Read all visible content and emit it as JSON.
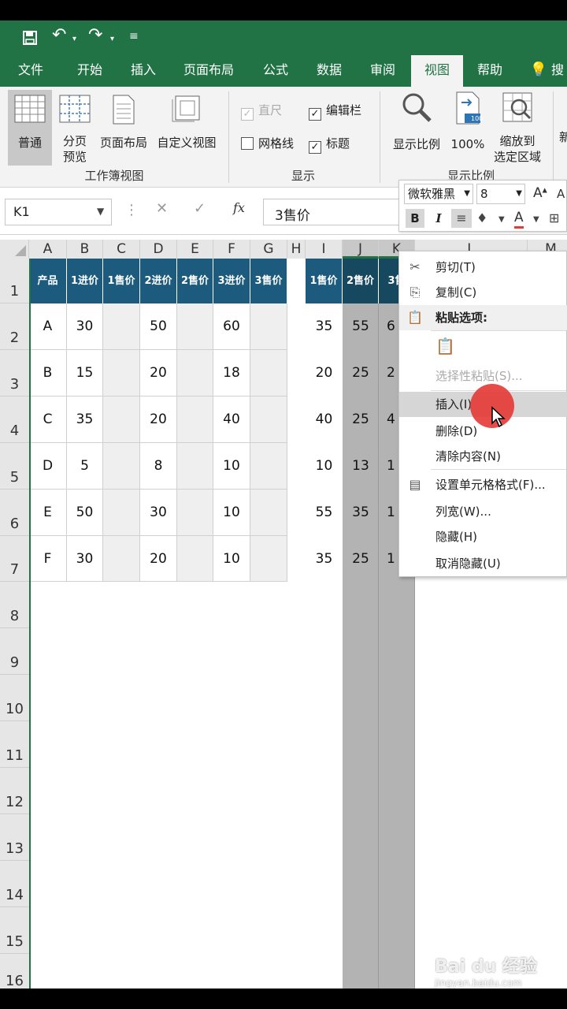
{
  "qat": {
    "save_icon": "save-icon",
    "undo_icon": "undo-icon",
    "redo_icon": "redo-icon",
    "customize_icon": "customize-qat-icon"
  },
  "tabs": [
    "文件",
    "开始",
    "插入",
    "页面布局",
    "公式",
    "数据",
    "审阅",
    "视图",
    "帮助"
  ],
  "tab_active": "视图",
  "tell_me_partial": "搜",
  "ribbon": {
    "normal": "普通",
    "pagebreak_1": "分页",
    "pagebreak_2": "预览",
    "pagelayout": "页面布局",
    "customview": "自定义视图",
    "group_workbook_views": "工作簿视图",
    "ruler": "直尺",
    "gridlines": "网格线",
    "formulabar": "编辑栏",
    "headings": "标题",
    "group_show": "显示",
    "zoom": "显示比例",
    "zoom100": "100%",
    "zoom100_badge": "100",
    "zoomsel_1": "缩放到",
    "zoomsel_2": "选定区域",
    "group_zoom": "显示比例",
    "partial_right": "新"
  },
  "namebox": "K1",
  "formula": "3售价",
  "fx": "fx",
  "columns": [
    "A",
    "B",
    "C",
    "D",
    "E",
    "F",
    "G",
    "H",
    "I",
    "J",
    "K",
    "L",
    "M"
  ],
  "rows": [
    "1",
    "2",
    "3",
    "4",
    "5",
    "6",
    "7",
    "8",
    "9",
    "10",
    "11",
    "12",
    "13",
    "14",
    "15",
    "16"
  ],
  "headers_left": [
    "产品",
    "1进价",
    "1售价",
    "2进价",
    "2售价",
    "3进价",
    "3售价"
  ],
  "headers_right": [
    "1售价",
    "2售价",
    "3售"
  ],
  "data_left": [
    [
      "A",
      "30",
      "",
      "50",
      "",
      "60",
      ""
    ],
    [
      "B",
      "15",
      "",
      "20",
      "",
      "18",
      ""
    ],
    [
      "C",
      "35",
      "",
      "20",
      "",
      "40",
      ""
    ],
    [
      "D",
      "5",
      "",
      "8",
      "",
      "10",
      ""
    ],
    [
      "E",
      "50",
      "",
      "30",
      "",
      "10",
      ""
    ],
    [
      "F",
      "30",
      "",
      "20",
      "",
      "10",
      ""
    ]
  ],
  "data_right": [
    [
      "35",
      "55",
      "6"
    ],
    [
      "20",
      "25",
      "2"
    ],
    [
      "40",
      "25",
      "4"
    ],
    [
      "10",
      "13",
      "1"
    ],
    [
      "55",
      "35",
      "1"
    ],
    [
      "35",
      "25",
      "1"
    ]
  ],
  "mini_toolbar": {
    "font": "微软雅黑",
    "size": "8",
    "bold": "B",
    "italic": "I",
    "font_color_letter": "A"
  },
  "menu": [
    {
      "label": "剪切(T)",
      "icon": "scissors-icon",
      "glyph": "✂",
      "state": "normal"
    },
    {
      "label": "复制(C)",
      "icon": "copy-icon",
      "glyph": "⎘",
      "state": "normal"
    },
    {
      "label": "粘贴选项:",
      "icon": "paste-icon",
      "glyph": "📋",
      "state": "header"
    },
    {
      "label": "",
      "icon": "paste-values-icon",
      "glyph": "📋",
      "state": "disabled"
    },
    {
      "label": "选择性粘贴(S)...",
      "icon": "",
      "glyph": "",
      "state": "disabled"
    },
    {
      "label": "插入(I)",
      "icon": "",
      "glyph": "",
      "state": "highlight"
    },
    {
      "label": "删除(D)",
      "icon": "",
      "glyph": "",
      "state": "normal"
    },
    {
      "label": "清除内容(N)",
      "icon": "",
      "glyph": "",
      "state": "normal"
    },
    {
      "label": "设置单元格格式(F)...",
      "icon": "format-cells-icon",
      "glyph": "▤",
      "state": "normal"
    },
    {
      "label": "列宽(W)...",
      "icon": "",
      "glyph": "",
      "state": "normal"
    },
    {
      "label": "隐藏(H)",
      "icon": "",
      "glyph": "",
      "state": "normal"
    },
    {
      "label": "取消隐藏(U)",
      "icon": "",
      "glyph": "",
      "state": "normal"
    }
  ],
  "watermark": "Bai du 经验",
  "watermark_url": "jingyan.baidu.com",
  "colors": {
    "excel_green": "#217346",
    "header_blue": "#1c5b7e",
    "selection_grey": "#b3b3b3",
    "click_red": "#e53935"
  }
}
